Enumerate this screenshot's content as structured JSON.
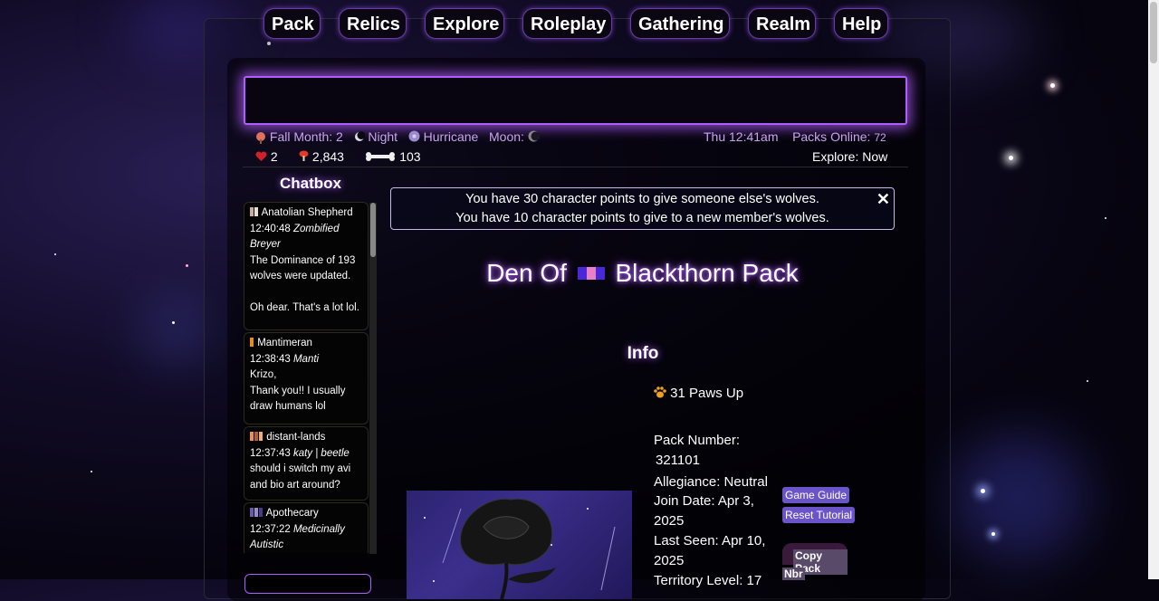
{
  "nav": {
    "items": [
      "Pack",
      "Relics",
      "Explore",
      "Roleplay",
      "Gathering",
      "Realm",
      "Help"
    ]
  },
  "status": {
    "season": "Fall Month: 2",
    "time_of_day": "Night",
    "weather": "Hurricane",
    "moon_label": "Moon:",
    "clock": "Thu 12:41am",
    "packs_online_label": "Packs Online:",
    "packs_online": "72",
    "explore_label": "Explore: Now"
  },
  "stats": {
    "hearts": "2",
    "mushrooms": "2,843",
    "bones": "103"
  },
  "chatbox": {
    "title": "Chatbox",
    "messages": [
      {
        "user": "Anatolian Shepherd",
        "time": "12:40:48",
        "nick": "Zombified Breyer",
        "text": "The Dominance of 193 wolves were updated.\n\nOh dear. That's a lot lol."
      },
      {
        "user": "Mantimeran",
        "time": "12:38:43",
        "nick": "Manti",
        "text": "Krizo,\nThank you!! I usually draw humans lol"
      },
      {
        "user": "distant-lands",
        "time": "12:37:43",
        "nick": "katy | beetle",
        "text": "should i switch my avi and bio art around?"
      },
      {
        "user": "Apothecary",
        "time": "12:37:22",
        "nick": "Medicinally Autistic",
        "text": ""
      }
    ]
  },
  "notice": {
    "line1": "You have 30 character points to give someone else's wolves.",
    "line2": "You have 10 character points to give to a new member's wolves.",
    "close": "✕"
  },
  "den": {
    "prefix": "Den Of",
    "pack_name": "Blackthorn Pack"
  },
  "info": {
    "title": "Info",
    "paws_up": "31 Paws Up",
    "pack_number_label": "Pack Number:",
    "pack_number": "321101",
    "allegiance": "Allegiance: Neutral",
    "join_date_1": "Join Date: Apr 3,",
    "join_date_2": "2025",
    "last_seen_1": "Last Seen: Apr 10,",
    "last_seen_2": "2025",
    "territory": "Territory Level: 17"
  },
  "buttons": {
    "game_guide": "Game Guide",
    "reset_tutorial": "Reset Tutorial",
    "copy_pack_nbr_1": "Copy Pack",
    "copy_pack_nbr_2": "Nbr"
  },
  "colors": {
    "accent": "#b05cff",
    "button_purple": "#6a55c8",
    "status_text": "#c9a4ee"
  }
}
